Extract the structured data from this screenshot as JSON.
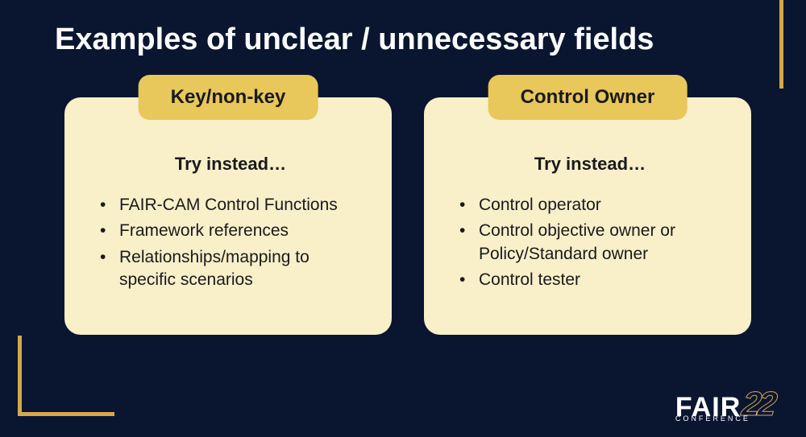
{
  "title": "Examples of unclear / unnecessary fields",
  "cards": [
    {
      "header": "Key/non-key",
      "subtitle": "Try instead…",
      "items": [
        "FAIR-CAM Control Functions",
        "Framework references",
        "Relationships/mapping to specific scenarios"
      ]
    },
    {
      "header": "Control Owner",
      "subtitle": "Try instead…",
      "items": [
        "Control operator",
        "Control objective owner or Policy/Standard owner",
        "Control tester"
      ]
    }
  ],
  "logo": {
    "fair": "FAIR",
    "conference": "CONFERENCE",
    "year": "22"
  }
}
